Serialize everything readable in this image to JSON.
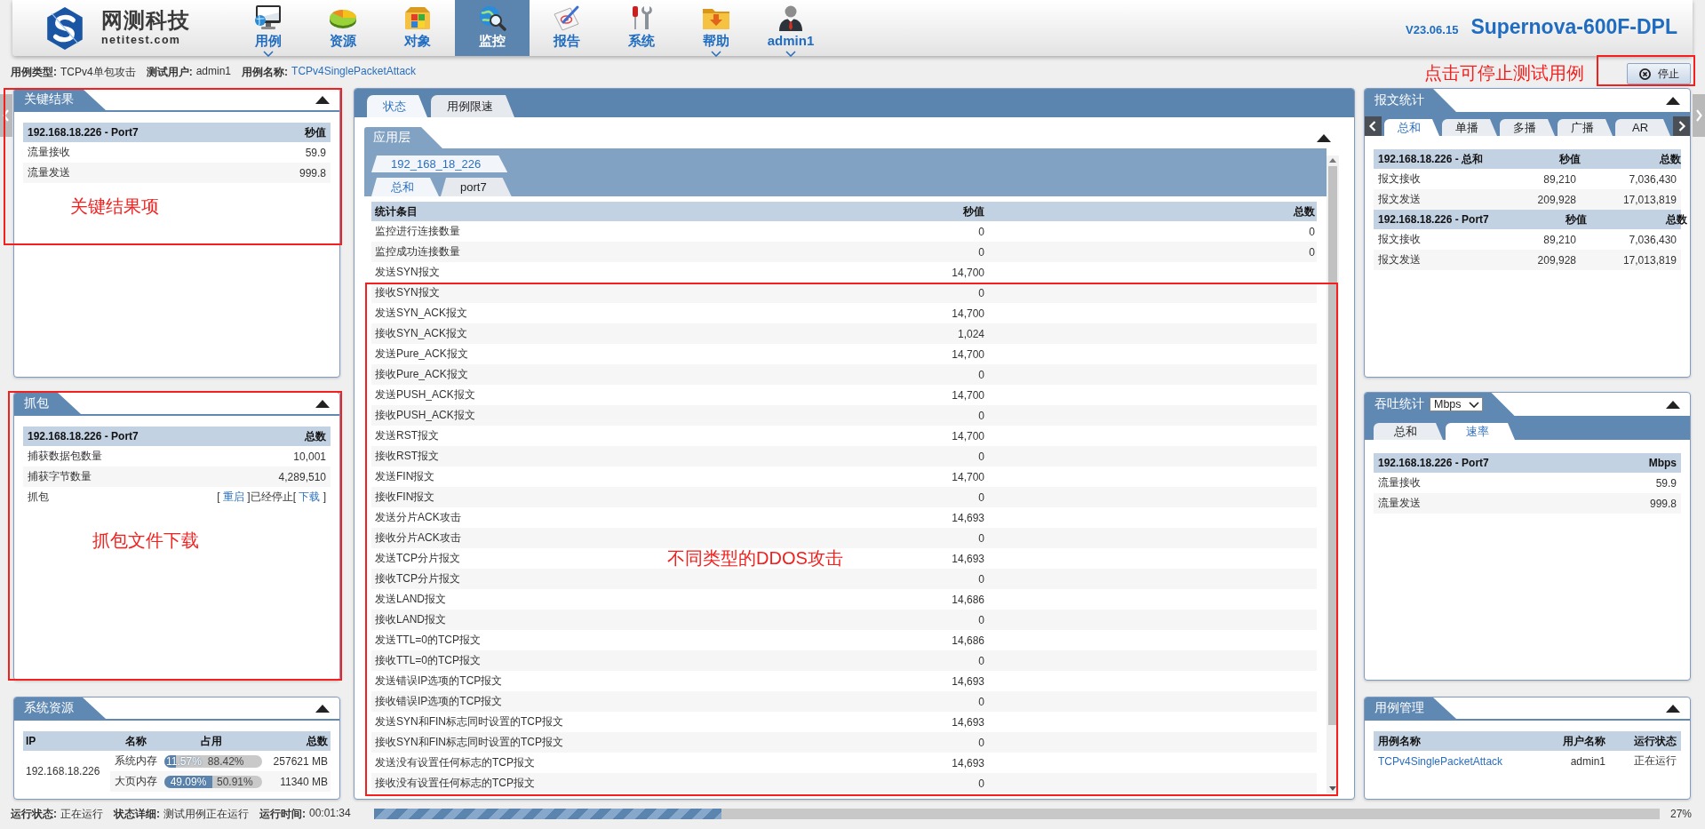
{
  "header": {
    "logo": {
      "name": "网测科技",
      "domain": "netitest.com"
    },
    "nav": [
      {
        "label": "用例",
        "selected": false,
        "dropdown": true
      },
      {
        "label": "资源",
        "selected": false,
        "dropdown": false
      },
      {
        "label": "对象",
        "selected": false,
        "dropdown": false
      },
      {
        "label": "监控",
        "selected": true,
        "dropdown": false
      },
      {
        "label": "报告",
        "selected": false,
        "dropdown": false
      },
      {
        "label": "系统",
        "selected": false,
        "dropdown": false
      },
      {
        "label": "帮助",
        "selected": false,
        "dropdown": true
      },
      {
        "label": "admin1",
        "selected": false,
        "dropdown": true
      }
    ],
    "version": "V23.06.15",
    "product": "Supernova-600F-DPL"
  },
  "info_bar": {
    "fields": [
      {
        "label": "用例类型:",
        "value": "TCPv4单包攻击",
        "kind": "text"
      },
      {
        "label": "测试用户:",
        "value": "admin1",
        "kind": "text"
      },
      {
        "label": "用例名称:",
        "value": "TCPv4SinglePacketAttack",
        "kind": "link"
      }
    ],
    "stop_button": {
      "label": "停止"
    },
    "annotation": {
      "text": "点击可停止测试用例"
    }
  },
  "key_results": {
    "title": "关键结果",
    "columns": [
      "192.168.18.226 - Port7",
      "秒值"
    ],
    "rows": [
      [
        "流量接收",
        "59.9"
      ],
      [
        "流量发送",
        "999.8"
      ]
    ],
    "annotation": {
      "text": "关键结果项"
    }
  },
  "capture": {
    "title": "抓包",
    "columns": [
      "192.168.18.226 - Port7",
      "总数"
    ],
    "rows": [
      {
        "kind": "value",
        "name": "捕获数据包数量",
        "value": "10,001"
      },
      {
        "kind": "value",
        "name": "捕获字节数量",
        "value": "4,289,510"
      },
      {
        "kind": "actions",
        "name": "抓包",
        "parts": [
          {
            "kind": "text",
            "text": "[ "
          },
          {
            "kind": "link",
            "text": "重启"
          },
          {
            "kind": "text",
            "text": " ]已经停止[ "
          },
          {
            "kind": "link",
            "text": "下载"
          },
          {
            "kind": "text",
            "text": " ]"
          }
        ]
      }
    ],
    "annotation": {
      "text": "抓包文件下载"
    }
  },
  "system_resources": {
    "title": "系统资源",
    "columns": [
      "IP",
      "名称",
      "占用",
      "总数"
    ],
    "ip": "192.168.18.226",
    "rows": [
      {
        "name": "系统内存",
        "level": 0.1157,
        "used": "11.57%",
        "free": "88.42%",
        "total": "257621 MB"
      },
      {
        "name": "大页内存",
        "level": 0.4909,
        "used": "49.09%",
        "free": "50.91%",
        "total": "11340 MB"
      }
    ]
  },
  "monitor": {
    "tabs": [
      {
        "label": "状态",
        "selected": true
      },
      {
        "label": "用例限速",
        "selected": false
      }
    ],
    "section": {
      "title": "应用层",
      "host_tabs": [
        {
          "label": "192_168_18_226",
          "selected": true
        }
      ],
      "port_tabs": [
        {
          "label": "总和",
          "selected": true
        },
        {
          "label": "port7",
          "selected": false
        }
      ],
      "columns": [
        "统计条目",
        "秒值",
        "总数"
      ],
      "rows": [
        {
          "name": "监控进行连接数量",
          "rate": "0",
          "total": "0"
        },
        {
          "name": "监控成功连接数量",
          "rate": "0",
          "total": "0"
        },
        {
          "name": "发送SYN报文",
          "rate": "14,700"
        }
      ],
      "annotation": {
        "text": "不同类型的DDOS攻击",
        "rows": [
          {
            "name": "接收SYN报文",
            "rate": "0"
          },
          {
            "name": "发送SYN_ACK报文",
            "rate": "14,700"
          },
          {
            "name": "接收SYN_ACK报文",
            "rate": "1,024"
          },
          {
            "name": "发送Pure_ACK报文",
            "rate": "14,700"
          },
          {
            "name": "接收Pure_ACK报文",
            "rate": "0"
          },
          {
            "name": "发送PUSH_ACK报文",
            "rate": "14,700"
          },
          {
            "name": "接收PUSH_ACK报文",
            "rate": "0"
          },
          {
            "name": "发送RST报文",
            "rate": "14,700"
          },
          {
            "name": "接收RST报文",
            "rate": "0"
          },
          {
            "name": "发送FIN报文",
            "rate": "14,700"
          },
          {
            "name": "接收FIN报文",
            "rate": "0"
          },
          {
            "name": "发送分片ACK攻击",
            "rate": "14,693"
          },
          {
            "name": "接收分片ACK攻击",
            "rate": "0"
          },
          {
            "name": "发送TCP分片报文",
            "rate": "14,693"
          },
          {
            "name": "接收TCP分片报文",
            "rate": "0"
          },
          {
            "name": "发送LAND报文",
            "rate": "14,686"
          },
          {
            "name": "接收LAND报文",
            "rate": "0"
          },
          {
            "name": "发送TTL=0的TCP报文",
            "rate": "14,686"
          },
          {
            "name": "接收TTL=0的TCP报文",
            "rate": "0"
          },
          {
            "name": "发送错误IP选项的TCP报文",
            "rate": "14,693"
          },
          {
            "name": "接收错误IP选项的TCP报文",
            "rate": "0"
          },
          {
            "name": "发送SYN和FIN标志同时设置的TCP报文",
            "rate": "14,693"
          },
          {
            "name": "接收SYN和FIN标志同时设置的TCP报文",
            "rate": "0"
          },
          {
            "name": "发送没有设置任何标志的TCP报文",
            "rate": "14,693"
          },
          {
            "name": "接收没有设置任何标志的TCP报文",
            "rate": "0"
          }
        ]
      }
    }
  },
  "packet_stats": {
    "title": "报文统计",
    "tabs": [
      {
        "label": "总和",
        "selected": true
      },
      {
        "label": "单播",
        "selected": false
      },
      {
        "label": "多播",
        "selected": false
      },
      {
        "label": "广播",
        "selected": false
      },
      {
        "label": "AR",
        "selected": false
      }
    ],
    "groups": [
      {
        "columns": [
          "192.168.18.226 - 总和",
          "秒值",
          "总数"
        ],
        "rows": [
          [
            "报文接收",
            "89,210",
            "7,036,430"
          ],
          [
            "报文发送",
            "209,928",
            "17,013,819"
          ]
        ]
      },
      {
        "columns": [
          "192.168.18.226 - Port7",
          "秒值",
          "总数"
        ],
        "rows": [
          [
            "报文接收",
            "89,210",
            "7,036,430"
          ],
          [
            "报文发送",
            "209,928",
            "17,013,819"
          ]
        ]
      }
    ]
  },
  "throughput": {
    "title": "吞吐统计",
    "unit": "Mbps",
    "tabs": [
      {
        "label": "总和",
        "selected": false
      },
      {
        "label": "速率",
        "selected": true
      }
    ],
    "columns": [
      "192.168.18.226 - Port7",
      "Mbps"
    ],
    "rows": [
      [
        "流量接收",
        "59.9"
      ],
      [
        "流量发送",
        "999.8"
      ]
    ]
  },
  "case_management": {
    "title": "用例管理",
    "columns": [
      "用例名称",
      "用户名称",
      "运行状态"
    ],
    "rows": [
      {
        "name": "TCPv4SinglePacketAttack",
        "user": "admin1",
        "status": "正在运行"
      }
    ]
  },
  "status_bar": {
    "fields": [
      {
        "label": "运行状态:",
        "value": "正在运行"
      },
      {
        "label": "状态详细:",
        "value": "测试用例正在运行"
      },
      {
        "label": "运行时间:",
        "value": "00:01:34"
      }
    ],
    "progress": {
      "level": 0.27,
      "text": "27%"
    }
  }
}
